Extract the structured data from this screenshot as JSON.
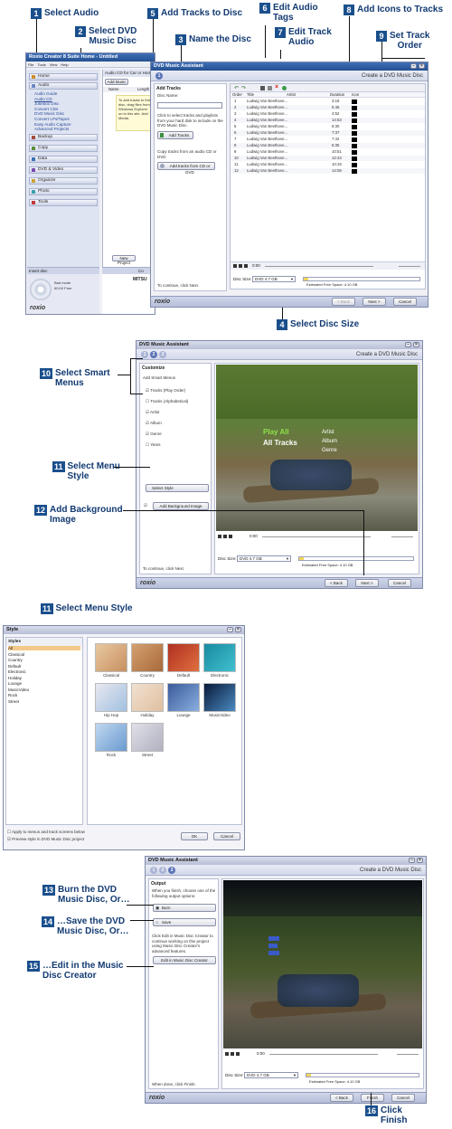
{
  "steps": [
    {
      "n": "1",
      "text": "Select Audio"
    },
    {
      "n": "2",
      "text": "Select DVD\nMusic Disc"
    },
    {
      "n": "3",
      "text": "Name the Disc"
    },
    {
      "n": "4",
      "text": "Select Disc Size"
    },
    {
      "n": "5",
      "text": "Add Tracks to Disc"
    },
    {
      "n": "6",
      "text": "Edit Audio\nTags"
    },
    {
      "n": "7",
      "text": "Edit Track\nAudio"
    },
    {
      "n": "8",
      "text": "Add Icons to Tracks"
    },
    {
      "n": "9",
      "text": "Set Track\nOrder"
    },
    {
      "n": "10",
      "text": "Select Smart\nMenus"
    },
    {
      "n": "11",
      "text": "Select Menu\nStyle"
    },
    {
      "n": "12",
      "text": "Add Background\nImage"
    },
    {
      "n": "11",
      "text": "Select Menu Style"
    },
    {
      "n": "13",
      "text": "Burn the DVD\nMusic Disc, Or…"
    },
    {
      "n": "14",
      "text": "…Save the DVD\nMusic Disc, Or…"
    },
    {
      "n": "15",
      "text": "…Edit in the Music\nDisc Creator"
    },
    {
      "n": "16",
      "text": "Click\nFinish"
    }
  ],
  "win1": {
    "title": "Roxio Creator 8 Suite Home - Untitled",
    "menu": [
      "File",
      "Tools",
      "View",
      "Help"
    ],
    "nav": [
      "Home",
      "Audio",
      "Backup",
      "Copy",
      "Data",
      "DVD & Video",
      "Organize",
      "Photo",
      "Tools"
    ],
    "audio_sub": [
      "Audio Guide",
      "Audio CD",
      "Jukebox Disc",
      "Convert CDs",
      "DVD Music Disc",
      "Convert LPs/Tapes",
      "Easy Audio Capture",
      "Advanced Projects"
    ],
    "panel_title": "Audio CD for Car or Home",
    "add_music": "Add Music",
    "col_name": "Name",
    "col_length": "Length",
    "note": "To add tracks to this disc, drag files from Windows Explorer on to this site. Add Media.",
    "new_project": "New Project",
    "insert_disc": "Insert disc",
    "disc_info": "Bad mode\n60:00 Free",
    "mitsu": "MITSU",
    "co": "Co",
    "logo": "roxio"
  },
  "dma": {
    "title": "DVD Music Assistant",
    "header": "Create a DVD Music Disc",
    "add_tracks_hdr": "Add Tracks",
    "disc_name_label": "Disc Name:",
    "instructions": "Click to select tracks and playlists from your hard disk to include on the DVD Music Disc.",
    "add_tracks_btn": "Add Tracks",
    "copy_instr": "Copy tracks from an audio CD or DVD",
    "add_from_cd": "Add tracks from CD or DVD",
    "continue_text": "To continue, click Next.",
    "cols": [
      "Order",
      "Title",
      "Artist",
      "Duration",
      "Icon"
    ],
    "tracks": [
      {
        "o": "1",
        "t": "Ludwig Van Beethove...",
        "d": "3:18"
      },
      {
        "o": "2",
        "t": "Ludwig Van Beethove...",
        "d": "5:46"
      },
      {
        "o": "3",
        "t": "Ludwig Van Beethove...",
        "d": "4:52"
      },
      {
        "o": "4",
        "t": "Ludwig Van Beethove...",
        "d": "14:53"
      },
      {
        "o": "5",
        "t": "Ludwig Van Beethove...",
        "d": "6:30"
      },
      {
        "o": "6",
        "t": "Ludwig Van Beethove...",
        "d": "7:37"
      },
      {
        "o": "7",
        "t": "Ludwig Van Beethove...",
        "d": "7:42"
      },
      {
        "o": "8",
        "t": "Ludwig Van Beethove...",
        "d": "6:35"
      },
      {
        "o": "9",
        "t": "Ludwig Van Beethove...",
        "d": "10:51"
      },
      {
        "o": "10",
        "t": "Ludwig Van Beethove...",
        "d": "12:43"
      },
      {
        "o": "11",
        "t": "Ludwig Van Beethove...",
        "d": "10:19"
      },
      {
        "o": "12",
        "t": "Ludwig Van Beethove...",
        "d": "14:08"
      }
    ],
    "time": "0:00",
    "disc_size_label": "Disc Size:",
    "disc_size_value": "DVD 4.7 GB",
    "free_space": "Estimated Free Space: 4.10 GB",
    "back": "< Back",
    "next": "Next >",
    "cancel": "Cancel",
    "logo": "roxio"
  },
  "dma2": {
    "title": "DVD Music Assistant",
    "header": "Create a DVD Music Disc",
    "section": "Customize",
    "smart_menus": "Add Smart Menus",
    "options": [
      "Tracks (Play Order)",
      "Tracks (Alphabetical)",
      "Artist",
      "Album",
      "Genre",
      "Years"
    ],
    "select_style": "Select Style",
    "add_bg": "Add Background Image",
    "continue_text": "To continue, click Next.",
    "menu_play_all": "Play All",
    "menu_all_tracks": "All Tracks",
    "menu_artist": "Artist",
    "menu_album": "Album",
    "menu_genre": "Genre",
    "time": "0:00",
    "disc_size_label": "Disc Size:",
    "disc_size_value": "DVD 4.7 GB",
    "free_space": "Estimated Free Space: 4.10 GB",
    "back": "< Back",
    "next": "Next >",
    "cancel": "Cancel",
    "logo": "roxio"
  },
  "style": {
    "title": "Style",
    "list_header": "Styles",
    "list": [
      "All",
      "Classical",
      "Country",
      "Default",
      "Electronic",
      "Holiday",
      "Lounge",
      "MusicVideo",
      "Rock",
      "Street"
    ],
    "thumbs": [
      "Classical",
      "Country",
      "Default",
      "Electronic",
      "Hip Hop",
      "Holiday",
      "Lounge",
      "MusicVideo",
      "Rock",
      "Street"
    ],
    "apply": "Apply to menus and track screens below",
    "preview": "Preview style in DVD Music Disc project",
    "ok": "OK",
    "cancel": "Cancel"
  },
  "dma3": {
    "title": "DVD Music Assistant",
    "header": "Create a DVD Music Disc",
    "section": "Output",
    "instr": "When you finish, choose one of the following output options:",
    "burn": "Burn",
    "save": "Save",
    "edit_instr": "Click Edit in Music Disc Creator to continue working on this project using Music Disc Creator's advanced features.",
    "edit_btn": "Edit in Music Disc Creator",
    "done_text": "When done, click Finish.",
    "time": "0:00",
    "disc_size_label": "Disc Size:",
    "disc_size_value": "DVD 4.7 GB",
    "free_space": "Estimated Free Space: 4.10 GB",
    "back": "< Back",
    "finish": "Finish",
    "cancel": "Cancel",
    "logo": "roxio"
  }
}
